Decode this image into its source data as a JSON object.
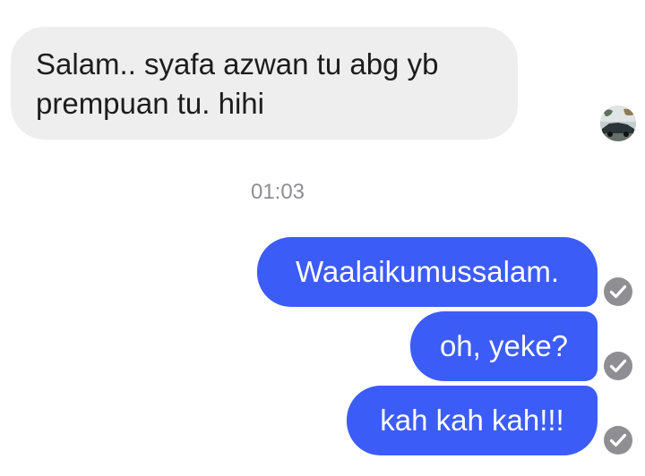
{
  "conversation": {
    "received": [
      {
        "line1": "Salam.. syafa azwan tu abg yb",
        "line2": "prempuan tu. hihi"
      }
    ],
    "timestamp": "01:03",
    "sent": [
      {
        "text": "Waalaikumussalam.",
        "status_icon": "delivered-check-icon"
      },
      {
        "text": "oh, yeke?",
        "status_icon": "delivered-check-icon"
      },
      {
        "text": "kah kah kah!!!",
        "status_icon": "delivered-check-icon"
      }
    ]
  },
  "colors": {
    "sent_bubble": "#3c5cf8",
    "received_bubble": "#eeeeee",
    "timestamp_text": "#8e8e93",
    "check_circle": "#8e8e93"
  }
}
